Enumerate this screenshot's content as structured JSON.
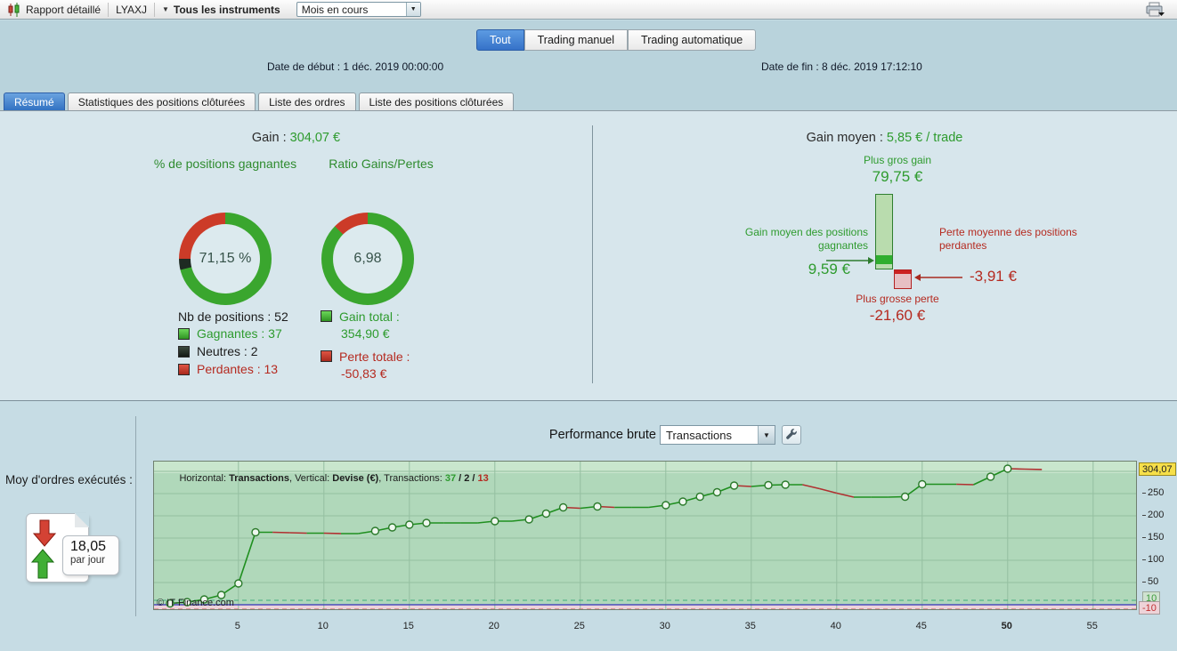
{
  "colors": {
    "green": "#2e9b2e",
    "red": "#b52a20",
    "donut_green": "#3aa62e",
    "donut_red": "#cc3b28",
    "donut_dark": "#1e2a22",
    "tab_blue": "#3572c8",
    "line_green": "#1f8f1f",
    "line_red": "#b03030"
  },
  "toolbar": {
    "title": "Rapport détaillé",
    "instrument": "LYAXJ",
    "instruments_menu": "Tous les instruments",
    "period_select": "Mois en cours"
  },
  "header": {
    "tabs": [
      {
        "label": "Tout"
      },
      {
        "label": "Trading manuel"
      },
      {
        "label": "Trading automatique"
      }
    ],
    "date_start": "Date de début :  1 déc. 2019 00:00:00",
    "date_end": "Date de fin :  8 déc. 2019 17:12:10"
  },
  "section_tabs": [
    {
      "label": "Résumé"
    },
    {
      "label": "Statistiques des positions clôturées"
    },
    {
      "label": "Liste des ordres"
    },
    {
      "label": "Liste des positions clôturées"
    }
  ],
  "summary_left": {
    "gain_label": "Gain : ",
    "gain_value": "304,07 €",
    "donut_pct": {
      "title": "% de positions gagnantes",
      "value": "71,15 %",
      "green_pct": 71.15,
      "neutral_pct": 3.85,
      "red_pct": 25.0
    },
    "donut_ratio": {
      "title": "Ratio Gains/Pertes",
      "value": "6,98",
      "green_pct": 87.5,
      "red_pct": 12.5
    },
    "nb_positions": "Nb de positions : 52",
    "legend": [
      {
        "label": "Gagnantes : 37",
        "color": "green"
      },
      {
        "label": "Neutres : 2",
        "color": "dark"
      },
      {
        "label": "Perdantes : 13",
        "color": "red"
      }
    ],
    "gain_total_label": "Gain total :",
    "gain_total_value": "354,90 €",
    "perte_totale_label": "Perte totale :",
    "perte_totale_value": "-50,83 €"
  },
  "summary_right": {
    "gain_moyen_label": "Gain moyen : ",
    "gain_moyen_value": "5,85 € / trade",
    "plus_gros_gain_label": "Plus gros gain",
    "plus_gros_gain_value": "79,75 €",
    "gain_moyen_gagnantes_label": "Gain moyen des positions gagnantes",
    "gain_moyen_gagnantes_value": "9,59 €",
    "perte_moyenne_label": "Perte moyenne des positions perdantes",
    "perte_moyenne_value": "-3,91 €",
    "plus_grosse_perte_label": "Plus grosse perte",
    "plus_grosse_perte_value": "-21,60 €"
  },
  "performance": {
    "title": "Performance brute",
    "select_value": "Transactions",
    "moy_ordres_label": "Moy d'ordres exécutés :",
    "moy_ordres_value": "18,05",
    "moy_ordres_unit": "par jour",
    "copyright": "© IT-Finance.com"
  },
  "chart_data": {
    "type": "line",
    "title": "Performance brute",
    "xlabel": "Transactions",
    "ylabel": "Devise (€)",
    "header": {
      "h_label": "Horizontal: ",
      "h_value": "Transactions",
      "v_label": ", Vertical: ",
      "v_value": "Devise (€)",
      "t_label": ", Transactions: ",
      "wins": "37",
      "sep": " / ",
      "neutrals": "2",
      "losses": "13"
    },
    "x_ticks": [
      5,
      10,
      15,
      20,
      25,
      30,
      35,
      40,
      45,
      50,
      55
    ],
    "x_bold_tick": 50,
    "y_ticks": [
      50,
      100,
      150,
      200,
      250
    ],
    "y_gridlines": [
      50,
      100,
      150,
      200,
      250,
      300
    ],
    "y_current": "304,07",
    "badge_upper": "10",
    "badge_lower": "-10",
    "threshold_upper": 10,
    "threshold_lower": -10,
    "ylim": [
      -14,
      322
    ],
    "xlim": [
      1,
      57
    ],
    "values": [
      3,
      6,
      12,
      22,
      48,
      163,
      163,
      162,
      161,
      161,
      160,
      160,
      166,
      174,
      180,
      184,
      184,
      184,
      184,
      188,
      188,
      192,
      205,
      219,
      217,
      221,
      219,
      219,
      219,
      224,
      232,
      243,
      253,
      268,
      266,
      269,
      270,
      270,
      261,
      251,
      242,
      242,
      242,
      243,
      271,
      271,
      271,
      270,
      288,
      306,
      305,
      304.07
    ]
  }
}
